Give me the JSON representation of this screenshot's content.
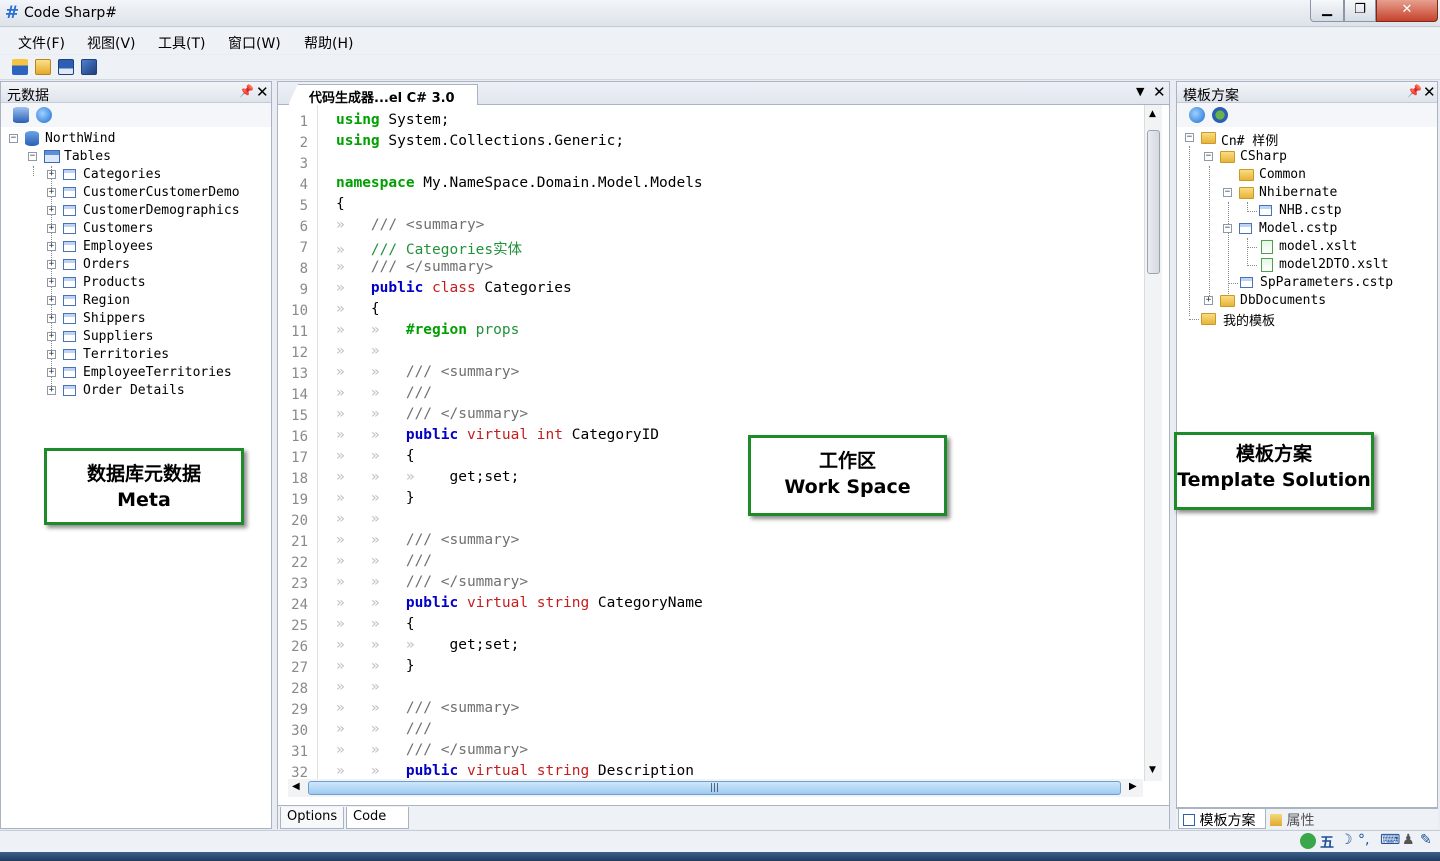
{
  "window": {
    "title": "Code Sharp#",
    "icon": "grid-app-icon",
    "buttons": {
      "minimize": "▁",
      "maximize": "❐",
      "close": "✕"
    }
  },
  "menu": [
    "文件(F)",
    "视图(V)",
    "工具(T)",
    "窗口(W)",
    "帮助(H)"
  ],
  "toolbar": [
    "database-icon",
    "open-folder-icon",
    "save-icon",
    "save-all-icon"
  ],
  "left_panel": {
    "title": "元数据",
    "root": "NorthWind",
    "group": "Tables",
    "tables": [
      "Categories",
      "CustomerCustomerDemo",
      "CustomerDemographics",
      "Customers",
      "Employees",
      "Orders",
      "Products",
      "Region",
      "Shippers",
      "Suppliers",
      "Territories",
      "EmployeeTerritories",
      "Order Details"
    ],
    "annotation": [
      "数据库元数据",
      "Meta"
    ]
  },
  "editor": {
    "tab": "代码生成器...el C# 3.0",
    "bottom_tabs": [
      "Options",
      "Code"
    ],
    "annotation": [
      "工作区",
      "Work Space"
    ],
    "line_numbers": [
      "1",
      "2",
      "3",
      "4",
      "5",
      "6",
      "7",
      "8",
      "9",
      "10",
      "11",
      "12",
      "13",
      "14",
      "15",
      "16",
      "17",
      "18",
      "19",
      "20",
      "21",
      "22",
      "23",
      "24",
      "25",
      "26",
      "27",
      "28",
      "29",
      "30",
      "31",
      "32"
    ],
    "lines": [
      [
        [
          "kw-g",
          "using"
        ],
        [
          "",
          "·System;"
        ]
      ],
      [
        [
          "kw-g",
          "using"
        ],
        [
          "",
          "·System.Collections.Generic;"
        ]
      ],
      [],
      [
        [
          "kw-g",
          "namespace"
        ],
        [
          "",
          "·My.NameSpace.Domain.Model.Models"
        ]
      ],
      [
        [
          "",
          "{"
        ],
        [
          "guide",
          "··"
        ]
      ],
      [
        [
          "guide",
          "»   "
        ],
        [
          "cm-dim",
          "///·<summary>"
        ]
      ],
      [
        [
          "guide",
          "»   "
        ],
        [
          "cm",
          "///·Categories实体"
        ]
      ],
      [
        [
          "guide",
          "»   "
        ],
        [
          "cm-dim",
          "///·</summary>"
        ]
      ],
      [
        [
          "guide",
          "»   "
        ],
        [
          "kw-b",
          "public"
        ],
        [
          "",
          ""
        ],
        [
          "kw-r",
          "·class"
        ],
        [
          "",
          "·Categories"
        ]
      ],
      [
        [
          "guide",
          "»   "
        ],
        [
          "",
          "{"
        ]
      ],
      [
        [
          "guide",
          "»   »   "
        ],
        [
          "kw-g",
          "#region"
        ],
        [
          "cm",
          "·props"
        ]
      ],
      [
        [
          "guide",
          "»   »"
        ]
      ],
      [
        [
          "guide",
          "»   »   "
        ],
        [
          "cm-dim",
          "///·<summary>"
        ]
      ],
      [
        [
          "guide",
          "»   »   "
        ],
        [
          "cm-dim",
          "///·"
        ]
      ],
      [
        [
          "guide",
          "»   »   "
        ],
        [
          "cm-dim",
          "///·</summary>"
        ]
      ],
      [
        [
          "guide",
          "»   »   "
        ],
        [
          "kw-b",
          "public"
        ],
        [
          "kw-r",
          "·virtual"
        ],
        [
          "kw-r",
          "·int"
        ],
        [
          "",
          "·CategoryID"
        ]
      ],
      [
        [
          "guide",
          "»   »   "
        ],
        [
          "",
          "{"
        ]
      ],
      [
        [
          "guide",
          "»   »   »    "
        ],
        [
          "",
          "get;set;"
        ],
        [
          "guide",
          "·"
        ]
      ],
      [
        [
          "guide",
          "»   »   "
        ],
        [
          "",
          "}"
        ]
      ],
      [
        [
          "guide",
          "»   »"
        ]
      ],
      [
        [
          "guide",
          "»   »   "
        ],
        [
          "cm-dim",
          "///·<summary>"
        ]
      ],
      [
        [
          "guide",
          "»   »   "
        ],
        [
          "cm-dim",
          "///·"
        ]
      ],
      [
        [
          "guide",
          "»   »   "
        ],
        [
          "cm-dim",
          "///·</summary>"
        ]
      ],
      [
        [
          "guide",
          "»   »   "
        ],
        [
          "kw-b",
          "public"
        ],
        [
          "kw-r",
          "·virtual"
        ],
        [
          "kw-r",
          "·string"
        ],
        [
          "",
          "·CategoryName"
        ]
      ],
      [
        [
          "guide",
          "»   »   "
        ],
        [
          "",
          "{"
        ]
      ],
      [
        [
          "guide",
          "»   »   »    "
        ],
        [
          "",
          "get;set;"
        ],
        [
          "guide",
          "·"
        ]
      ],
      [
        [
          "guide",
          "»   »   "
        ],
        [
          "",
          "}"
        ]
      ],
      [
        [
          "guide",
          "»   »"
        ]
      ],
      [
        [
          "guide",
          "»   »   "
        ],
        [
          "cm-dim",
          "///·<summary>"
        ]
      ],
      [
        [
          "guide",
          "»   »   "
        ],
        [
          "cm-dim",
          "///·"
        ]
      ],
      [
        [
          "guide",
          "»   »   "
        ],
        [
          "cm-dim",
          "///·</summary>"
        ]
      ],
      [
        [
          "guide",
          "»   »   "
        ],
        [
          "kw-b",
          "public"
        ],
        [
          "kw-r",
          "·virtual"
        ],
        [
          "kw-r",
          "·string"
        ],
        [
          "",
          "·Description"
        ]
      ]
    ]
  },
  "right_panel": {
    "title": "模板方案",
    "tree": {
      "root": "Cn# 样例",
      "csharp": "CSharp",
      "common": "Common",
      "nhibernate": "Nhibernate",
      "nhb": "NHB.cstp",
      "model": "Model.cstp",
      "model_xslt": "model.xslt",
      "model2dto": "model2DTO.xslt",
      "spparams": "SpParameters.cstp",
      "dbdocs": "DbDocuments",
      "mine": "我的模板"
    },
    "annotation": [
      "模板方案",
      "Template Solution"
    ],
    "bottom_tabs": [
      "模板方案",
      "属性"
    ]
  },
  "tray": [
    "五",
    "⌨"
  ],
  "colors": {
    "annotation_border": "#1f8a2a",
    "keyword_green": "#00a000",
    "keyword_blue": "#0000c8",
    "keyword_red": "#c41d1d"
  }
}
